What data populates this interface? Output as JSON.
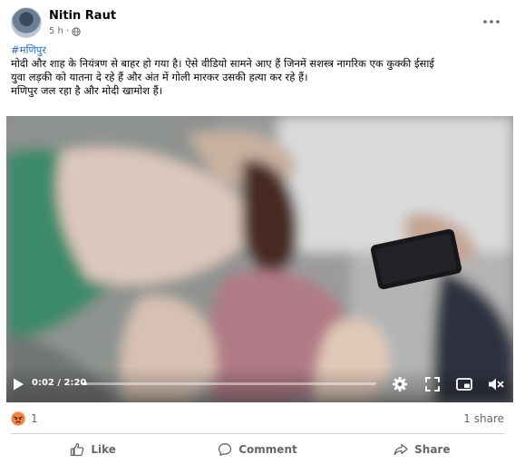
{
  "post": {
    "author": "Nitin Raut",
    "timestamp": "5 h",
    "separator": "·",
    "privacy_icon": "globe-icon",
    "hashtag": "#मणिपुर",
    "lines": [
      "मोदी और शाह के नियंत्रण से बाहर हो गया है।  ऐसे वीडियो सामने आए हैं जिनमें सशस्त्र नागरिक एक कुक्की ईसाई",
      "युवा लड़की को यातना दे रहे हैं और अंत में गोली मारकर उसकी हत्या कर रहे हैं।",
      " मणिपुर जल रहा है और मोदी खामोश हैं।"
    ]
  },
  "video": {
    "time": "0:02 / 2:20",
    "progress": 0.014,
    "icons": [
      "play-icon",
      "settings-icon",
      "fullscreen-icon",
      "picture-in-picture-icon",
      "volume-icon"
    ]
  },
  "engagement": {
    "reaction_icon": "angry-icon",
    "reaction_count": "1",
    "share_count": "1 share"
  },
  "actions": {
    "like": "Like",
    "comment": "Comment",
    "share": "Share"
  },
  "colors": {
    "hashtag": "#216fdb",
    "secondary_text": "#65676b",
    "angry_reaction": "#f0643c"
  }
}
